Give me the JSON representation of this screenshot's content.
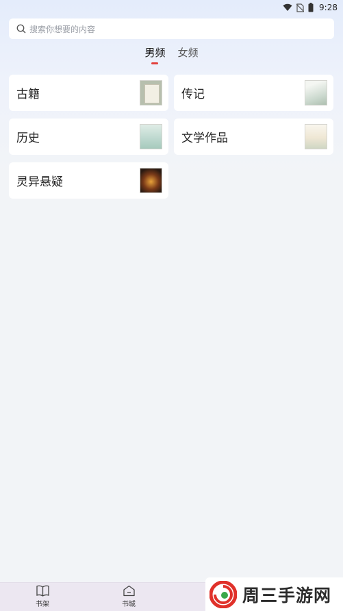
{
  "status_bar": {
    "time": "9:28",
    "icons": [
      "wifi-icon",
      "no-sim-icon",
      "battery-icon"
    ]
  },
  "search": {
    "placeholder": "搜索你想要的内容",
    "icon": "search-icon"
  },
  "tabs": [
    {
      "label": "男频",
      "active": true
    },
    {
      "label": "女频",
      "active": false
    }
  ],
  "categories": [
    {
      "label": "古籍"
    },
    {
      "label": "传记"
    },
    {
      "label": "历史"
    },
    {
      "label": "文学作品"
    },
    {
      "label": "灵异悬疑"
    }
  ],
  "bottom_nav": [
    {
      "label": "书架",
      "icon": "book-open-icon"
    },
    {
      "label": "书城",
      "icon": "home-icon"
    }
  ],
  "watermark": {
    "text": "周三手游网",
    "colors": {
      "red": "#e0312a",
      "green": "#3aa84a"
    }
  },
  "colors": {
    "accent": "#e2403c",
    "background": "#f2f4f7"
  }
}
